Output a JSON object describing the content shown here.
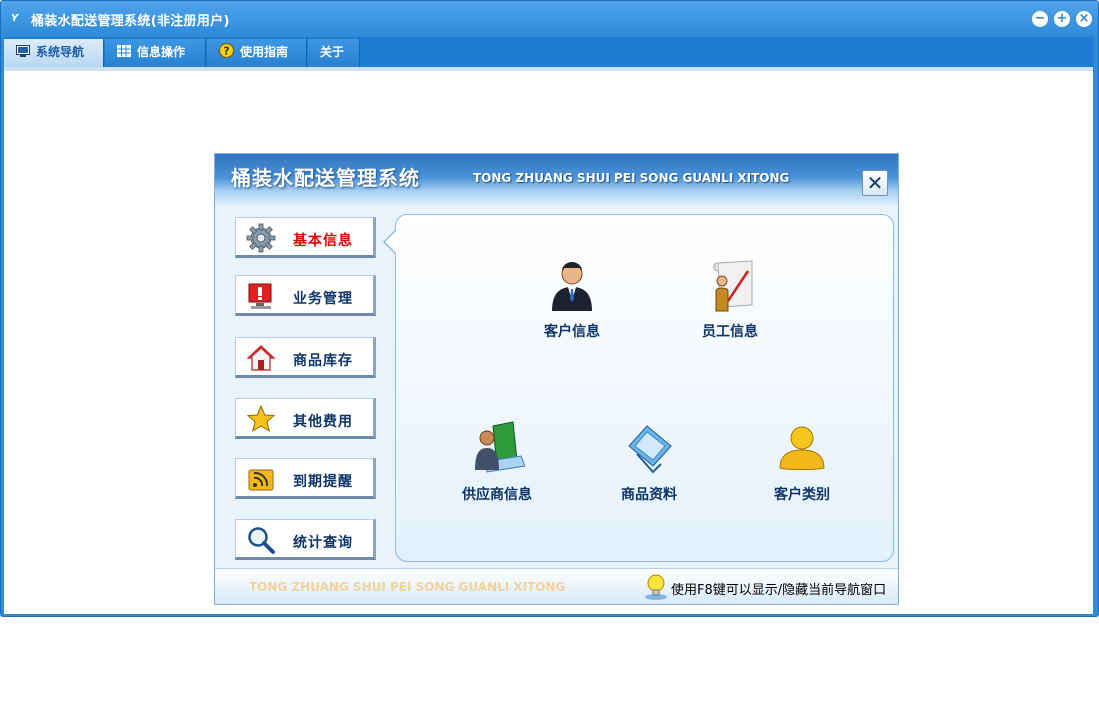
{
  "window": {
    "logo_text": "Y",
    "title": "桶装水配送管理系统(非注册用户)",
    "minimize_symbol": "−",
    "maximize_symbol": "+",
    "close_symbol": "×"
  },
  "tabs": [
    {
      "label": "系统导航",
      "icon": "monitor-icon",
      "active": true
    },
    {
      "label": "信息操作",
      "icon": "grid-icon",
      "active": false
    },
    {
      "label": "使用指南",
      "icon": "help-icon",
      "active": false
    },
    {
      "label": "关于",
      "icon": "",
      "active": false
    }
  ],
  "nav": {
    "title_cn": "桶装水配送管理系统",
    "title_en": "TONG ZHUANG SHUI PEI SONG GUANLI XITONG",
    "close_symbol": "✕",
    "menu": [
      {
        "label": "基本信息",
        "icon": "gear-icon",
        "active": true
      },
      {
        "label": "业务管理",
        "icon": "alert-monitor-icon",
        "active": false
      },
      {
        "label": "商品库存",
        "icon": "home-icon",
        "active": false
      },
      {
        "label": "其他费用",
        "icon": "star-icon",
        "active": false
      },
      {
        "label": "到期提醒",
        "icon": "rss-icon",
        "active": false
      },
      {
        "label": "统计查询",
        "icon": "magnifier-icon",
        "active": false
      }
    ],
    "functions": [
      {
        "label": "客户信息",
        "icon": "businessman-icon"
      },
      {
        "label": "员工信息",
        "icon": "employee-scroll-icon"
      },
      {
        "label": "供应商信息",
        "icon": "supplier-book-icon"
      },
      {
        "label": "商品资料",
        "icon": "product-cards-icon"
      },
      {
        "label": "客户类别",
        "icon": "user-category-icon"
      }
    ],
    "footer_en": "TONG ZHUANG SHUI PEI SONG GUANLI XITONG",
    "footer_tip": "使用F8键可以显示/隐藏当前导航窗口",
    "colors": {
      "accent": "#2f8ad8",
      "active_menu_text": "#e30000",
      "menu_text": "#0e3568"
    }
  }
}
